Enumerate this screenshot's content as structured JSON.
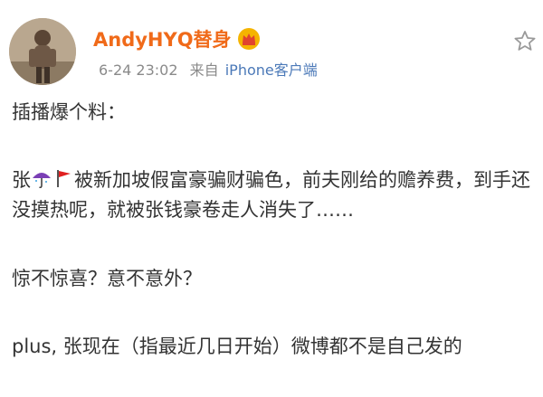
{
  "post": {
    "author": "AndyHYQ替身",
    "timestamp": "6-24 23:02",
    "source_prefix": "来自",
    "source_device": "iPhone客户端",
    "icons": {
      "avatar": "avatar-photo",
      "badge": "crown-badge-icon",
      "favorite": "star-icon",
      "umbrella": "umbrella-emoji-icon",
      "flag": "red-flag-emoji-icon"
    },
    "colors": {
      "author": "#f06a19",
      "device": "#4b79b8",
      "meta": "#8a8a8a",
      "text": "#333333"
    },
    "content": {
      "line1": "插播爆个料：",
      "p2_prefix": "张",
      "p2_text": "被新加坡假富豪骗财骗色，前夫刚给的赡养费，到手还没摸热呢，就被张钱豪卷走人消失了……",
      "line3": "惊不惊喜？意不意外？",
      "line4": "plus, 张现在（指最近几日开始）微博都不是自己发的"
    }
  }
}
